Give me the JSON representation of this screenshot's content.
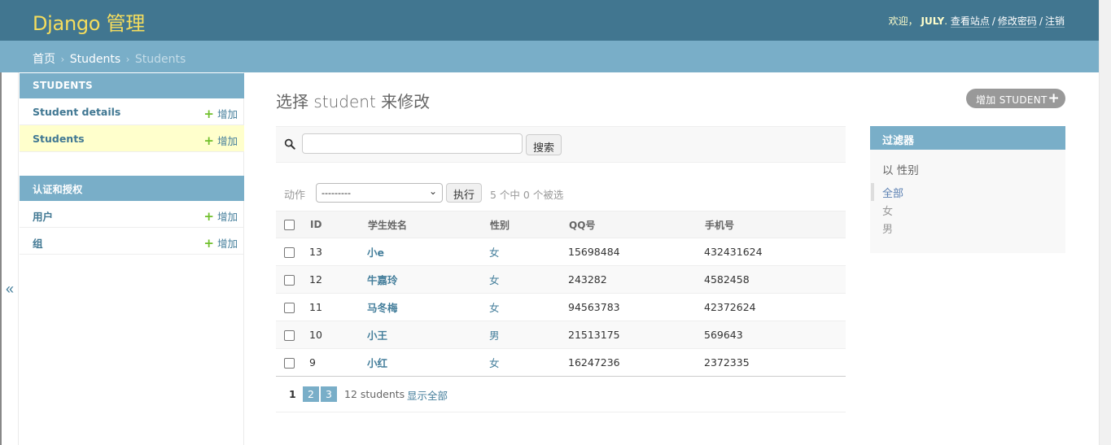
{
  "header": {
    "brand": "Django 管理",
    "welcome": "欢迎，",
    "username": "JULY",
    "view_site": "查看站点",
    "change_password": "修改密码",
    "logout": "注销",
    "separator": "/"
  },
  "breadcrumbs": {
    "home": "首页",
    "app": "Students",
    "current": "Students",
    "arrow": "›"
  },
  "sidebar": {
    "toggle": "«",
    "modules": [
      {
        "caption": "STUDENTS",
        "items": [
          {
            "label": "Student details",
            "add": "增加"
          },
          {
            "label": "Students",
            "add": "增加"
          }
        ]
      },
      {
        "caption": "认证和授权",
        "items": [
          {
            "label": "用户",
            "add": "增加"
          },
          {
            "label": "组",
            "add": "增加"
          }
        ]
      }
    ]
  },
  "content": {
    "title": "选择 student 来修改",
    "add_button": "增加 STUDENT",
    "search_button": "搜索",
    "action_label": "动作",
    "action_selected": "---------",
    "go_button": "执行",
    "selection_count": "5 个中 0 个被选"
  },
  "table": {
    "columns": [
      "ID",
      "学生姓名",
      "性别",
      "QQ号",
      "手机号"
    ],
    "rows": [
      {
        "id": "13",
        "name": "小e",
        "sex": "女",
        "qq": "15698484",
        "phone": "432431624"
      },
      {
        "id": "12",
        "name": "牛嘉玲",
        "sex": "女",
        "qq": "243282",
        "phone": "4582458"
      },
      {
        "id": "11",
        "name": "马冬梅",
        "sex": "女",
        "qq": "94563783",
        "phone": "42372624"
      },
      {
        "id": "10",
        "name": "小王",
        "sex": "男",
        "qq": "21513175",
        "phone": "569643"
      },
      {
        "id": "9",
        "name": "小红",
        "sex": "女",
        "qq": "16247236",
        "phone": "2372335"
      }
    ]
  },
  "paginator": {
    "current": "1",
    "pages": [
      "2",
      "3"
    ],
    "total": "12 students",
    "show_all": "显示全部"
  },
  "filter": {
    "title": "过滤器",
    "by": "以 性别",
    "options": [
      "全部",
      "女",
      "男"
    ]
  },
  "colors": {
    "header_bg": "#417690",
    "brand": "#f5dd5d",
    "breadcrumb_bg": "#79aec8",
    "link": "#447e9b",
    "current_row": "#ffffcc",
    "add_plus": "#70bf2b"
  }
}
